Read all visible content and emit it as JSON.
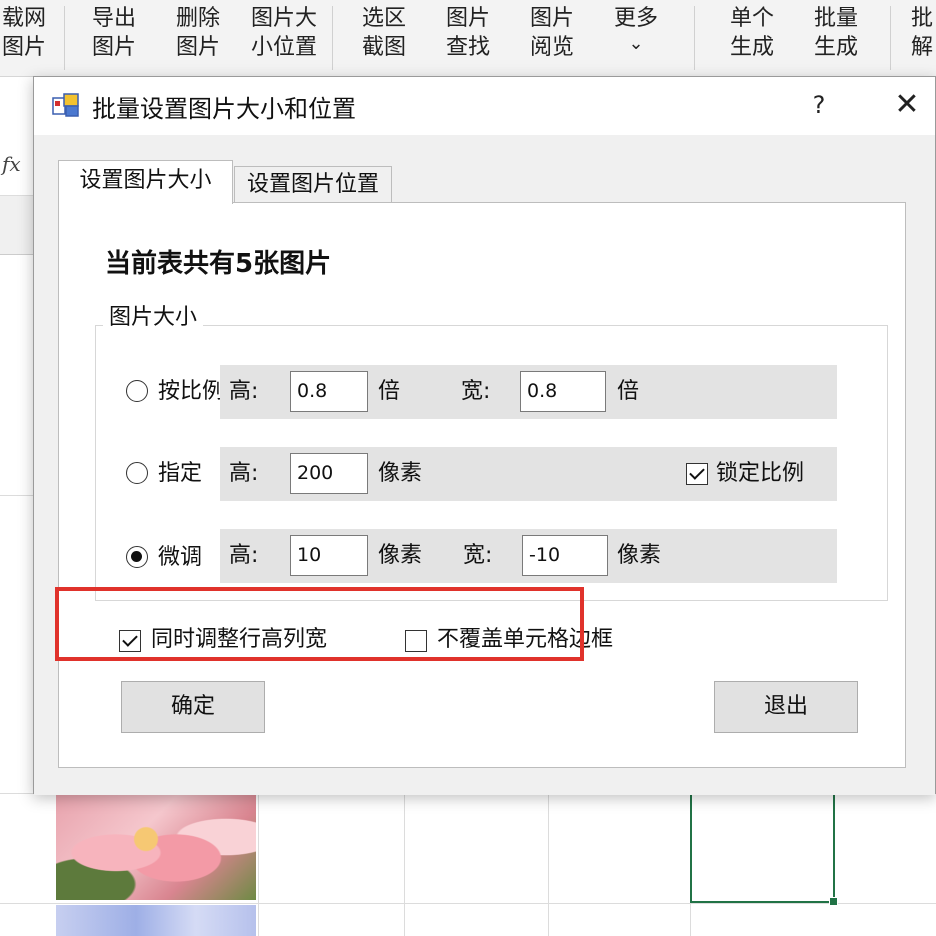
{
  "ribbon": {
    "buttons": [
      {
        "line1": "载网",
        "line2": "图片"
      },
      {
        "line1": "导出",
        "line2": "图片"
      },
      {
        "line1": "删除",
        "line2": "图片"
      },
      {
        "line1": "图片大",
        "line2": "小位置"
      },
      {
        "line1": "选区",
        "line2": "截图"
      },
      {
        "line1": "图片",
        "line2": "查找"
      },
      {
        "line1": "图片",
        "line2": "阅览"
      },
      {
        "line1": "更多",
        "line2": "⌄"
      },
      {
        "line1": "单个",
        "line2": "生成"
      },
      {
        "line1": "批量",
        "line2": "生成"
      },
      {
        "line1": "批",
        "line2": "解"
      }
    ]
  },
  "sheet": {
    "fx_label": "fx"
  },
  "dialog": {
    "title": "批量设置图片大小和位置",
    "help": "?",
    "close": "✕",
    "tabs": [
      "设置图片大小",
      "设置图片位置"
    ],
    "count_text": "当前表共有5张图片",
    "group_label": "图片大小",
    "height_label": "高:",
    "width_label": "宽:",
    "rows": {
      "ratio": {
        "label": "按比例",
        "height": "0.8",
        "height_unit": "倍",
        "width": "0.8",
        "width_unit": "倍",
        "selected": false
      },
      "fixed": {
        "label": "指定",
        "height": "200",
        "height_unit": "像素",
        "lock_label": "锁定比例",
        "lock_checked": true,
        "selected": false
      },
      "adjust": {
        "label": "微调",
        "height": "10",
        "height_unit": "像素",
        "width": "-10",
        "width_unit": "像素",
        "selected": true
      }
    },
    "options": {
      "sync_label": "同时调整行高列宽",
      "sync_checked": true,
      "border_label": "不覆盖单元格边框",
      "border_checked": false
    },
    "buttons": {
      "ok": "确定",
      "exit": "退出"
    }
  },
  "colors": {
    "highlight": "#e0322b",
    "selection": "#217346"
  }
}
